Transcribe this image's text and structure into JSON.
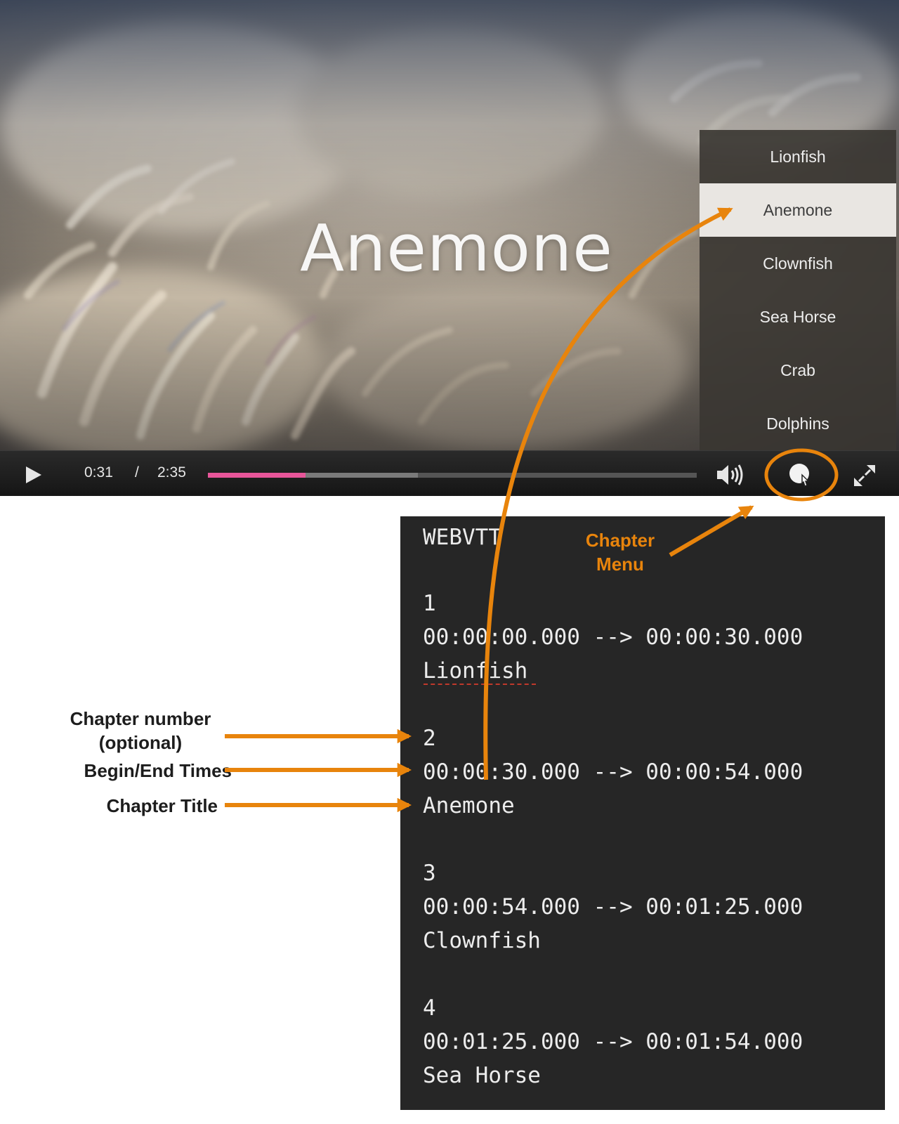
{
  "video": {
    "title_overlay": "Anemone"
  },
  "chapter_menu": {
    "items": [
      "Lionfish",
      "Anemone",
      "Clownfish",
      "Sea Horse",
      "Crab",
      "Dolphins"
    ],
    "selected_index": 1
  },
  "controls": {
    "current_time": "0:31",
    "separator": "/",
    "total_time": "2:35",
    "played_fraction": 0.2,
    "buffered_fraction": 0.43,
    "play_icon": "play-icon",
    "volume_icon": "volume-icon",
    "chapters_icon": "chapters-icon",
    "fullscreen_icon": "fullscreen-icon"
  },
  "vtt": {
    "header": "WEBVTT",
    "cues": [
      {
        "number": "1",
        "times": "00:00:00.000 --> 00:00:30.000",
        "title": "Lionfish"
      },
      {
        "number": "2",
        "times": "00:00:30.000 --> 00:00:54.000",
        "title": "Anemone"
      },
      {
        "number": "3",
        "times": "00:00:54.000 --> 00:01:25.000",
        "title": "Clownfish"
      },
      {
        "number": "4",
        "times": "00:01:25.000 --> 00:01:54.000",
        "title": "Sea Horse"
      }
    ]
  },
  "annotations": {
    "chapter_menu_callout": [
      "Chapter",
      "Menu"
    ],
    "chapter_number_label": [
      "Chapter number",
      "(optional)"
    ],
    "times_label": "Begin/End Times",
    "title_label": "Chapter Title"
  },
  "colors": {
    "accent_orange": "#e8840c",
    "progress_pink": "#e8569a",
    "code_background": "#262626"
  }
}
